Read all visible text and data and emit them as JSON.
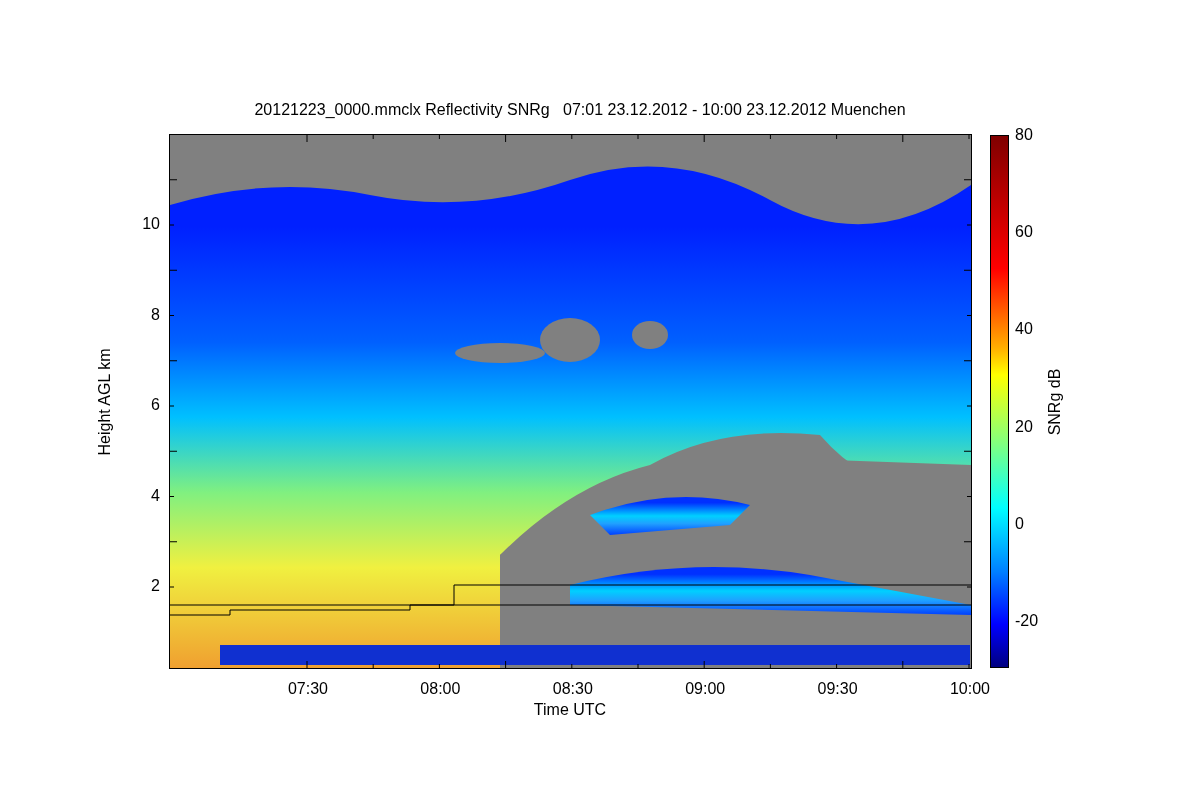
{
  "title": "20121223_0000.mmclx Reflectivity SNRg   07:01 23.12.2012 - 10:00 23.12.2012 Muenchen",
  "plot": {
    "ylabel": "Height AGL km",
    "xlabel": "Time UTC",
    "yticks": [
      "10",
      "8",
      "6",
      "4",
      "2"
    ],
    "xticks": [
      "07:30",
      "08:00",
      "08:30",
      "09:00",
      "09:30",
      "10:00"
    ]
  },
  "colorbar": {
    "label": "SNRg dB",
    "ticks": [
      "80",
      "60",
      "40",
      "20",
      "0",
      "-20"
    ]
  }
}
